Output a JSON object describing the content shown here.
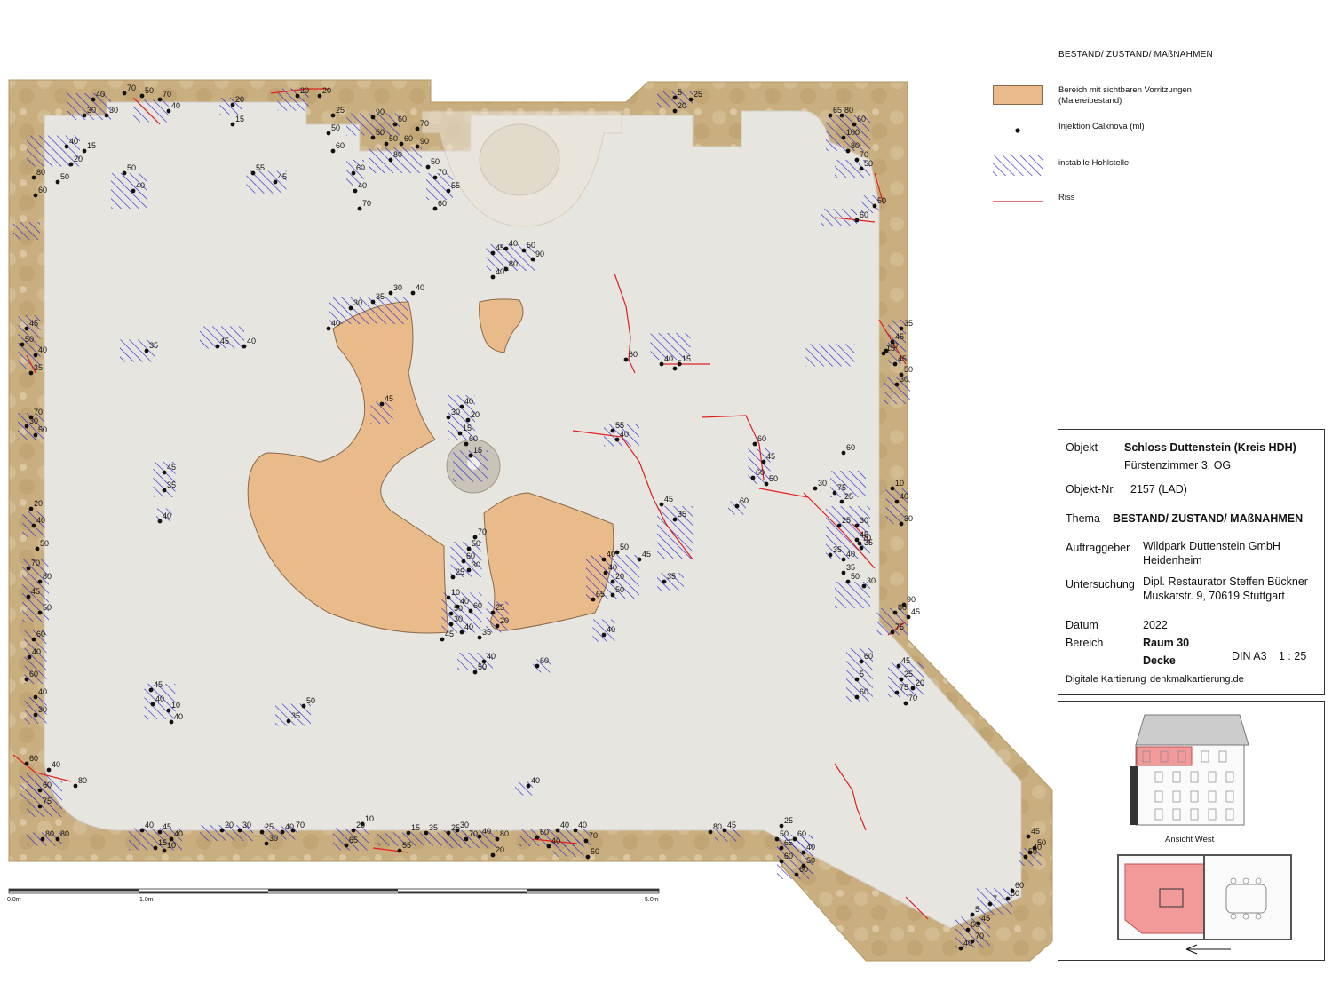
{
  "legend": {
    "title": "BESTAND/ ZUSTAND/ MAßNAHMEN",
    "items": [
      {
        "key": "vorritzungen",
        "text": "Bereich mit sichtbaren Vorritzungen",
        "text2": "(Malereibestand)",
        "color": "#e9bb8a"
      },
      {
        "key": "injektion",
        "text": "Injektion Calxnova (ml)",
        "color": "#111111"
      },
      {
        "key": "hohlstelle",
        "text": "instabile Hohlstelle",
        "color": "#2b2bd6"
      },
      {
        "key": "riss",
        "text": "Riss",
        "color": "#e02020"
      }
    ]
  },
  "titleblock": {
    "objekt_label": "Objekt",
    "objekt_value": "Schloss Duttenstein (Kreis HDH)",
    "objekt_sub": "Fürstenzimmer 3. OG",
    "objektnr_label": "Objekt-Nr.",
    "objektnr_value": "2157 (LAD)",
    "thema_label": "Thema",
    "thema_value": "BESTAND/ ZUSTAND/ MAßNAHMEN",
    "auftraggeber_label": "Auftraggeber",
    "auftraggeber_value1": "Wildpark Duttenstein GmbH",
    "auftraggeber_value2": "Heidenheim",
    "untersuchung_label": "Untersuchung",
    "untersuchung_value1": "Dipl. Restaurator Steffen Bückner",
    "untersuchung_value2": "Muskatstr. 9, 70619 Stuttgart",
    "datum_label": "Datum",
    "datum_value": "2022",
    "bereich_label": "Bereich",
    "bereich_value1": "Raum 30",
    "bereich_value2": "Decke",
    "format": "DIN A3",
    "massstab": "1 : 25",
    "footer_label": "Digitale Kartierung",
    "footer_value": "denkmalkartierung.de"
  },
  "reference": {
    "elevation_caption": "Ansicht West",
    "highlight_color": "#f29a9a"
  },
  "scalebar": {
    "labels": [
      "0.0m",
      "1.0m",
      "5.0m"
    ]
  },
  "colors": {
    "ceiling": "#e7e5e0",
    "border": "#c8ad7c",
    "hatch": "#2b2bd6",
    "crack": "#e02020",
    "orange": "#e9bb8a"
  },
  "injection_labels": [
    "40",
    "70",
    "50",
    "70",
    "40",
    "30",
    "30",
    "20",
    "15",
    "20",
    "20",
    "25",
    "50",
    "60",
    "90",
    "60",
    "50",
    "70",
    "50",
    "60",
    "80",
    "90",
    "50",
    "70",
    "5",
    "25",
    "20",
    "65",
    "80",
    "60",
    "100",
    "80",
    "70",
    "50",
    "40",
    "15",
    "20",
    "50",
    "60",
    "80",
    "50",
    "40",
    "55",
    "45",
    "60",
    "40",
    "70",
    "55",
    "60",
    "45",
    "40",
    "50",
    "90",
    "80",
    "40",
    "30",
    "40",
    "35",
    "30",
    "40",
    "35",
    "45",
    "40",
    "45",
    "50",
    "40",
    "35",
    "45",
    "30",
    "40",
    "20",
    "15",
    "60",
    "15",
    "70",
    "30",
    "50",
    "60",
    "40",
    "15",
    "5",
    "45",
    "50",
    "30",
    "35",
    "40",
    "60",
    "45",
    "60",
    "50",
    "55",
    "40",
    "60",
    "30",
    "75",
    "25",
    "25",
    "30",
    "35",
    "40",
    "50",
    "30",
    "10",
    "40",
    "30",
    "45",
    "35",
    "40",
    "20",
    "40",
    "50",
    "70",
    "80",
    "45",
    "50",
    "60",
    "40",
    "60",
    "40",
    "30",
    "70",
    "50",
    "60",
    "25",
    "30",
    "10",
    "40",
    "50",
    "60",
    "30",
    "40",
    "45",
    "35",
    "25",
    "20",
    "40",
    "50",
    "45",
    "40",
    "20",
    "65",
    "50",
    "40",
    "35",
    "45",
    "35",
    "60",
    "40",
    "50",
    "60",
    "45",
    "40",
    "10",
    "40",
    "35",
    "50",
    "60",
    "5",
    "60",
    "45",
    "25",
    "20",
    "75",
    "70",
    "90",
    "45",
    "80",
    "75",
    "60",
    "40",
    "80",
    "60",
    "75",
    "80",
    "80",
    "40",
    "45",
    "15",
    "10",
    "40",
    "20",
    "30",
    "25",
    "30",
    "40",
    "70",
    "20",
    "10",
    "65",
    "15",
    "35",
    "25",
    "30",
    "70",
    "40",
    "80",
    "20",
    "55",
    "60",
    "40",
    "40",
    "70",
    "40",
    "50",
    "80",
    "45",
    "25",
    "60",
    "50",
    "65",
    "40",
    "60",
    "50",
    "60",
    "45",
    "40",
    "50",
    "50",
    "60",
    "80",
    "7",
    "5",
    "45",
    "60",
    "40",
    "70",
    "40",
    "50",
    "60",
    "70",
    "35",
    "45",
    "35",
    "15",
    "45"
  ]
}
